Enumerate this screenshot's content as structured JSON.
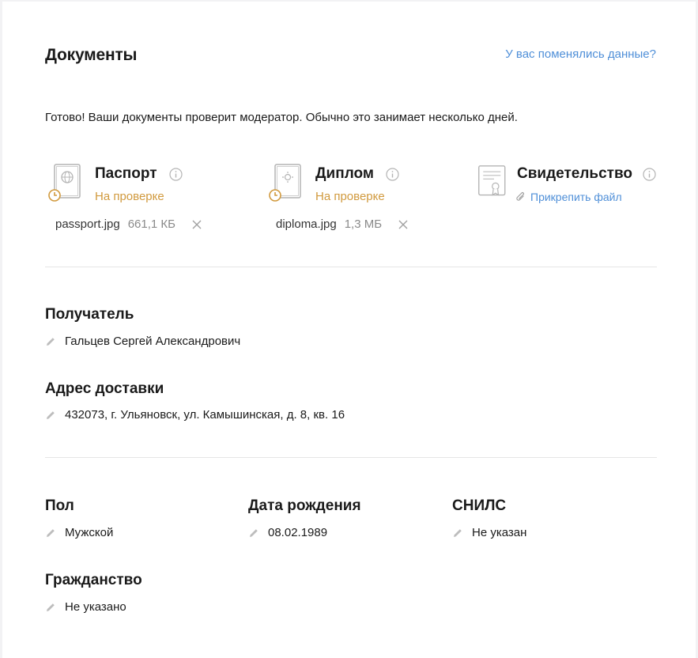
{
  "header": {
    "title": "Документы",
    "changed_link": "У вас поменялись данные?"
  },
  "notice": "Готово! Ваши документы проверит модератор. Обычно это занимает несколько дней.",
  "documents": [
    {
      "name": "Паспорт",
      "status": "На проверке",
      "file_name": "passport.jpg",
      "file_size": "661,1 КБ",
      "icon": "passport-icon"
    },
    {
      "name": "Диплом",
      "status": "На проверке",
      "file_name": "diploma.jpg",
      "file_size": "1,3 МБ",
      "icon": "diploma-icon"
    },
    {
      "name": "Свидетельство",
      "attach_label": "Прикрепить файл",
      "icon": "certificate-icon"
    }
  ],
  "recipient": {
    "label": "Получатель",
    "value": "Гальцев Сергей Александрович"
  },
  "address": {
    "label": "Адрес доставки",
    "value": "432073, г. Ульяновск, ул. Камышинская, д. 8, кв. 16"
  },
  "gender": {
    "label": "Пол",
    "value": "Мужской"
  },
  "birth_date": {
    "label": "Дата рождения",
    "value": "08.02.1989"
  },
  "snils": {
    "label": "СНИЛС",
    "value": "Не указан"
  },
  "citizenship": {
    "label": "Гражданство",
    "value": "Не указано"
  },
  "colors": {
    "accent_link": "#4f8fd8",
    "status_pending": "#d19a3e",
    "icon_gray": "#b4b4b4"
  }
}
